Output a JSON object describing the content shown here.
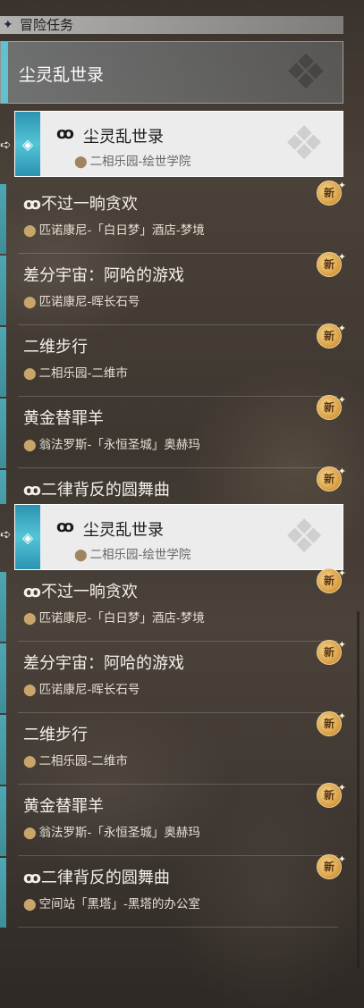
{
  "header": {
    "title": "冒险任务",
    "icon": "diamond-icon"
  },
  "category": {
    "title": "尘灵乱世录"
  },
  "selected": {
    "title": "尘灵乱世录",
    "location": "二相乐园-绘世学院",
    "icon": "quest-glyph-icon"
  },
  "badge_label": "新",
  "missions": [
    {
      "title": "不过一晌贪欢",
      "location": "匹诺康尼-「白日梦」酒店-梦境",
      "has_glyph": true
    },
    {
      "title": "差分宇宙：阿哈的游戏",
      "location": "匹诺康尼-晖长石号",
      "has_glyph": false
    },
    {
      "title": "二维步行",
      "location": "二相乐园-二维市",
      "has_glyph": false
    },
    {
      "title": "黄金替罪羊",
      "location": "翁法罗斯-「永恒圣城」奥赫玛",
      "has_glyph": false
    },
    {
      "title": "二律背反的圆舞曲",
      "location": "空间站「黑塔」-黑塔的办公室",
      "has_glyph": true
    }
  ],
  "colors": {
    "accent": "#53c4d6",
    "badge": "#d79a3e",
    "selected_bg": "#ececec"
  }
}
